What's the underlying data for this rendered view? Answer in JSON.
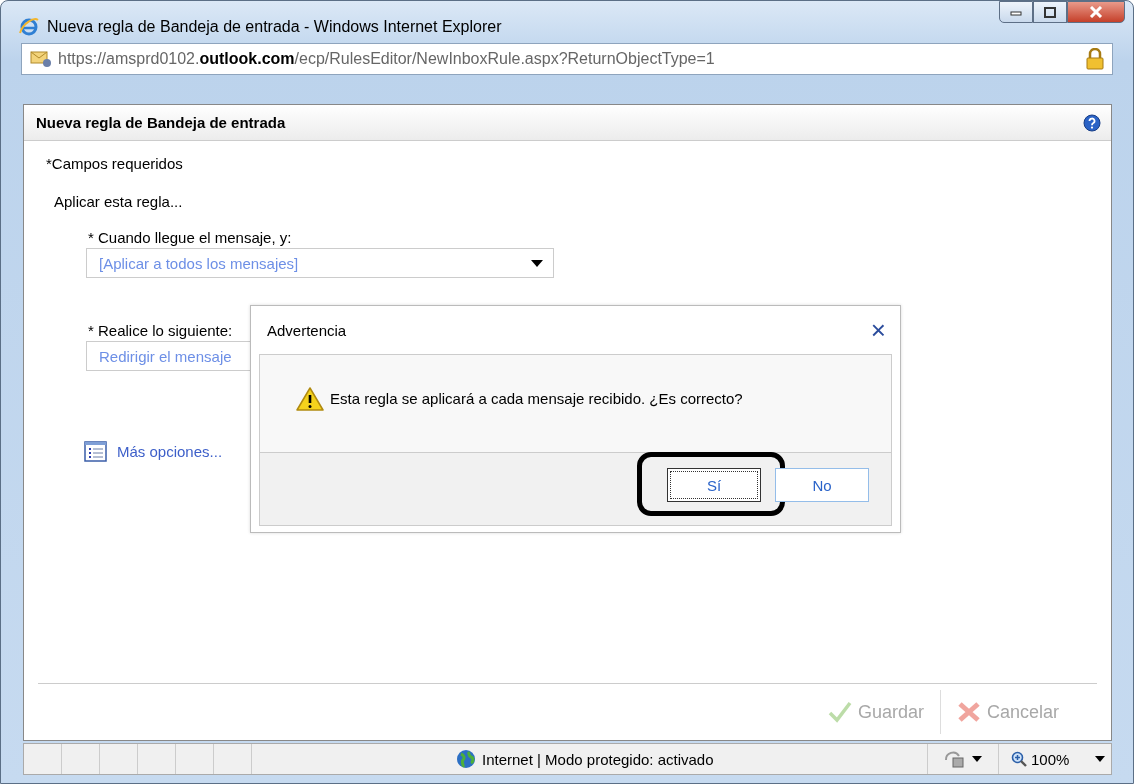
{
  "window": {
    "title": "Nueva regla de Bandeja de entrada - Windows Internet Explorer"
  },
  "address_bar": {
    "url": "https://amsprd0102.**outlook.com**/ecp/RulesEditor/NewInboxRule.aspx?ReturnObjectType=1"
  },
  "panel": {
    "title": "Nueva regla de Bandeja de entrada"
  },
  "form": {
    "required_note": "*Campos requeridos",
    "section": "Aplicar esta regla...",
    "fields": [
      {
        "label": "* Cuando llegue el mensaje, y:",
        "value": "[Aplicar a todos los mensajes]",
        "kind": "dropdown"
      },
      {
        "label": "* Realice lo siguiente:",
        "value": "Redirigir el mensaje",
        "kind": "text"
      }
    ],
    "more_options": "Más opciones..."
  },
  "dialog": {
    "title": "Advertencia",
    "close": "×",
    "message": "Esta regla se aplicará a cada mensaje recibido. ¿Es correcto?",
    "buttons": [
      {
        "label": "Sí",
        "focused": true,
        "highlighted": true
      },
      {
        "label": "No",
        "focused": false,
        "highlighted": false
      }
    ]
  },
  "footer_buttons": [
    {
      "label": "Guardar",
      "kind": "save",
      "disabled": true
    },
    {
      "label": "Cancelar",
      "kind": "cancel",
      "disabled": true
    }
  ],
  "status_bar": {
    "zone": "Internet | Modo protegido: activado",
    "zoom": "100%"
  }
}
